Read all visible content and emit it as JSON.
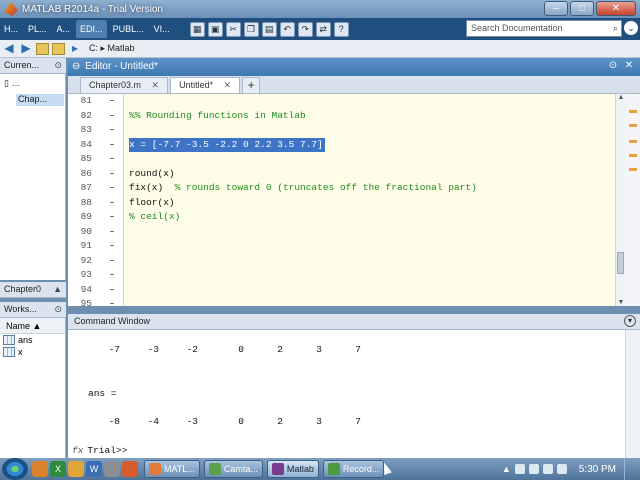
{
  "window": {
    "title": "MATLAB R2014a - Trial Version"
  },
  "ribbon": {
    "tabs": [
      "H...",
      "PL...",
      "A...",
      "EDI...",
      "PUBL...",
      "VI..."
    ],
    "active_tab": 3,
    "search_placeholder": "Search Documentation"
  },
  "address": {
    "path": "C: ▸ Matlab"
  },
  "current_folder": {
    "title": "Curren...",
    "item": "Chap...",
    "details_title": "Chapter0"
  },
  "workspace": {
    "title": "Works...",
    "column": "Name ▲",
    "vars": [
      "ans",
      "x"
    ]
  },
  "editor": {
    "title": "Editor - Untitled*",
    "tabs": [
      {
        "label": "Chapter03.m",
        "closable": true,
        "active": false
      },
      {
        "label": "Untitled*",
        "closable": true,
        "active": true
      }
    ],
    "add_tab": "+",
    "lines": [
      {
        "n": "81",
        "code": "",
        "kind": "plain"
      },
      {
        "n": "82",
        "code": "%% Rounding functions in Matlab",
        "kind": "comment"
      },
      {
        "n": "83",
        "code": "",
        "kind": "plain"
      },
      {
        "n": "84",
        "code": "x = [-7.7 -3.5 -2.2 0 2.2 3.5 7.7]",
        "kind": "selected"
      },
      {
        "n": "85",
        "code": "",
        "kind": "plain"
      },
      {
        "n": "86",
        "code": "round(x)",
        "kind": "plain"
      },
      {
        "n": "87",
        "code": "fix(x)",
        "comment": "  % rounds toward 0 (truncates off the fractional part)",
        "kind": "mixed"
      },
      {
        "n": "88",
        "code": "floor(x)",
        "kind": "plain"
      },
      {
        "n": "89",
        "code": "% ceil(x)",
        "kind": "comment"
      },
      {
        "n": "90",
        "code": "",
        "kind": "plain"
      },
      {
        "n": "91",
        "code": "",
        "kind": "plain"
      },
      {
        "n": "92",
        "code": "",
        "kind": "plain"
      },
      {
        "n": "93",
        "code": "",
        "kind": "plain"
      },
      {
        "n": "94",
        "code": "",
        "kind": "plain"
      },
      {
        "n": "95",
        "code": "",
        "kind": "plain"
      }
    ]
  },
  "command_window": {
    "title": "Command Window",
    "row1": [
      "-7",
      "-3",
      "-2",
      "0",
      "2",
      "3",
      "7"
    ],
    "ans_label": "ans =",
    "row2": [
      "-8",
      "-4",
      "-3",
      "0",
      "2",
      "3",
      "7"
    ],
    "prompt": "Trial>>"
  },
  "taskbar": {
    "apps": [
      "MATL...",
      "Camta...",
      "Matlab",
      "Record..."
    ],
    "time": "5:30 PM"
  }
}
